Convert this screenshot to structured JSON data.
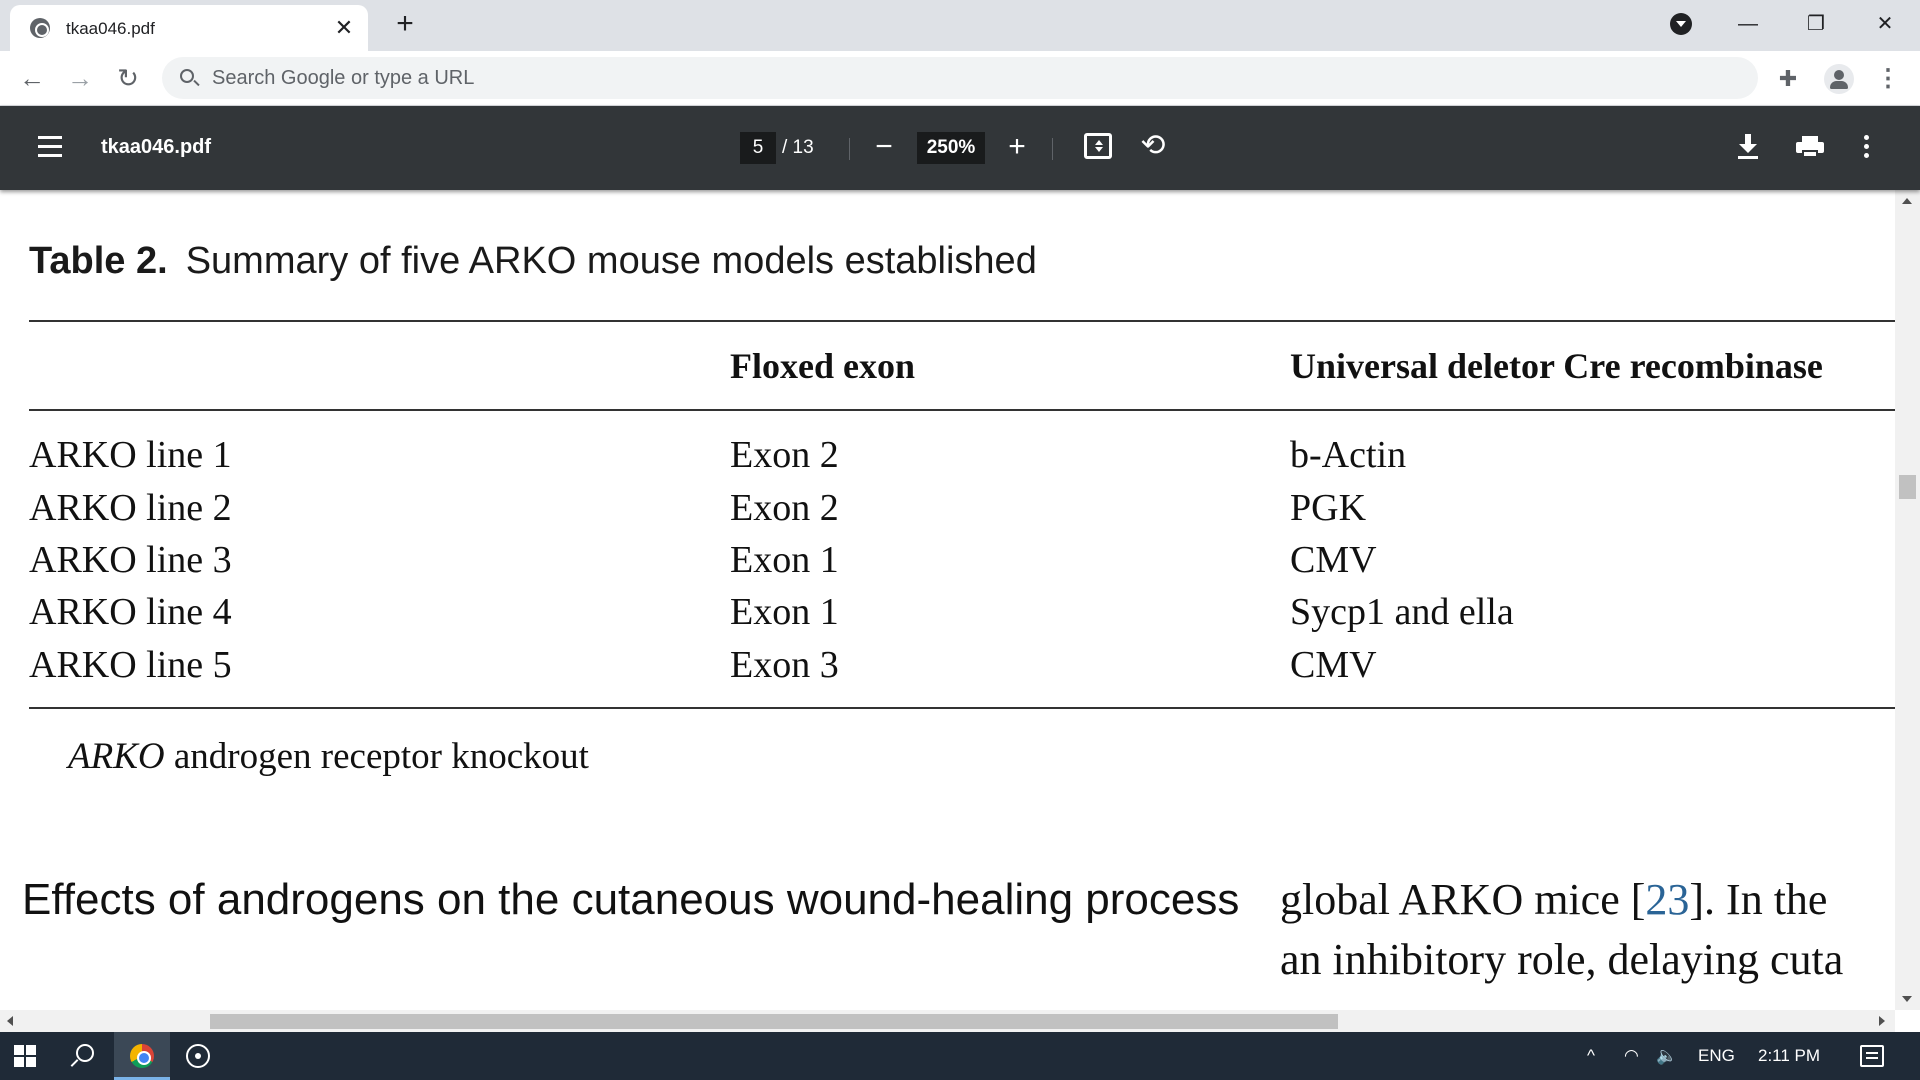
{
  "browser": {
    "tab_title": "tkaa046.pdf",
    "tab_close": "✕",
    "new_tab": "+",
    "omnibox_placeholder": "Search Google or type a URL",
    "window_controls": {
      "minimize": "—",
      "restore": "❐",
      "close": "✕"
    },
    "nav": {
      "back": "←",
      "forward": "→",
      "reload": "↻"
    },
    "extensions_icon": "puzzle-piece",
    "menu": "⋮"
  },
  "pdf_toolbar": {
    "filename": "tkaa046.pdf",
    "current_page": "5",
    "total_pages": "/ 13",
    "zoom_out": "−",
    "zoom": "250%",
    "zoom_in": "+",
    "rotate": "⟲"
  },
  "document": {
    "table_label": "Table 2.",
    "table_title": "Summary of five ARKO mouse models established",
    "columns": [
      "",
      "Floxed exon",
      "Universal deletor Cre recombinase"
    ],
    "rows": [
      [
        "ARKO line 1",
        "Exon 2",
        "b-Actin"
      ],
      [
        "ARKO line 2",
        "Exon 2",
        "PGK"
      ],
      [
        "ARKO line 3",
        "Exon 1",
        "CMV"
      ],
      [
        "ARKO line 4",
        "Exon 1",
        "Sycp1 and ella"
      ],
      [
        "ARKO line 5",
        "Exon 3",
        "CMV"
      ]
    ],
    "footnote_abbr": "ARKO",
    "footnote_text": " androgen receptor knockout",
    "section_heading": "Effects of androgens on the cutaneous wound-healing process",
    "right_col_line1_pre": "global ARKO mice [",
    "right_col_line1_ref": "23",
    "right_col_line1_post": "]. In the",
    "right_col_line2": "an inhibitory role, delaying cuta"
  },
  "taskbar": {
    "language": "ENG",
    "time": "2:11 PM",
    "tray_chevron": "^"
  }
}
